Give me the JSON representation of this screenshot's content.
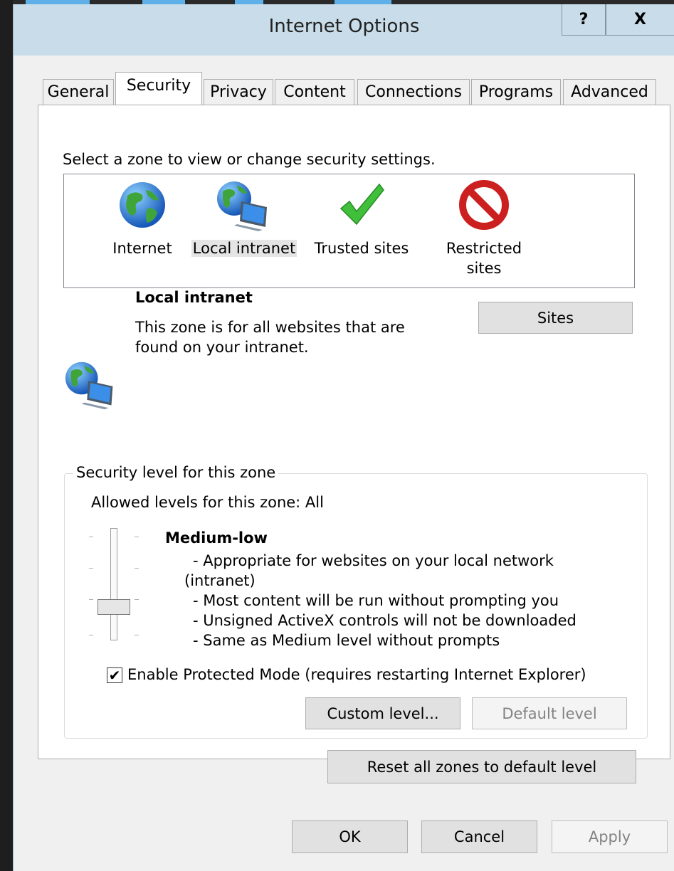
{
  "window": {
    "title": "Internet Options",
    "help_label": "?",
    "close_label": "X"
  },
  "tabs": [
    {
      "label": "General",
      "active": false
    },
    {
      "label": "Security",
      "active": true
    },
    {
      "label": "Privacy",
      "active": false
    },
    {
      "label": "Content",
      "active": false
    },
    {
      "label": "Connections",
      "active": false
    },
    {
      "label": "Programs",
      "active": false
    },
    {
      "label": "Advanced",
      "active": false
    }
  ],
  "security": {
    "instruction": "Select a zone to view or change security settings.",
    "zones": [
      {
        "label_line1": "Internet",
        "label_line2": "",
        "icon": "globe-icon"
      },
      {
        "label_line1": "Local intranet",
        "label_line2": "",
        "icon": "intranet-icon",
        "selected": true
      },
      {
        "label_line1": "Trusted sites",
        "label_line2": "",
        "icon": "checkmark-icon"
      },
      {
        "label_line1": "Restricted",
        "label_line2": "sites",
        "icon": "prohibited-icon"
      }
    ],
    "selected_zone": {
      "name": "Local intranet",
      "description_line1": "This zone is for all websites that are",
      "description_line2": "found on your intranet."
    },
    "sites_button": "Sites",
    "level_group": {
      "legend": "Security level for this zone",
      "allowed": "Allowed levels for this zone: All",
      "level_name": "Medium-low",
      "details": [
        "- Appropriate for websites on your local network",
        "(intranet)",
        "- Most content will be run without prompting you",
        "- Unsigned ActiveX controls will not be downloaded",
        "- Same as Medium level without prompts"
      ],
      "slider": {
        "positions": 4,
        "selected_index": 1
      }
    },
    "protected_mode": {
      "label": "Enable Protected Mode (requires restarting Internet Explorer)",
      "checked": true,
      "mark": "✔"
    },
    "custom_level_button": "Custom level...",
    "default_level_button": "Default level",
    "reset_all_button": "Reset all zones to default level"
  },
  "footer": {
    "ok": "OK",
    "cancel": "Cancel",
    "apply": "Apply"
  },
  "colors": {
    "title_bar": "#c8dde9",
    "panel": "#ffffff",
    "button": "#e1e1e1"
  }
}
